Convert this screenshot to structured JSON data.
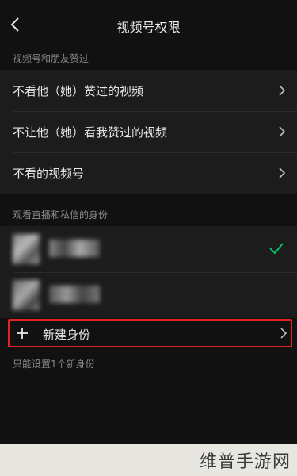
{
  "header": {
    "title": "视频号权限"
  },
  "section1": {
    "label": "视频号和朋友赞过",
    "items": [
      {
        "label": "不看他（她）赞过的视频"
      },
      {
        "label": "不让他（她）看我赞过的视频"
      },
      {
        "label": "不看的视频号"
      }
    ]
  },
  "section2": {
    "label": "观看直播和私信的身份",
    "identities": [
      {
        "selected": true
      },
      {
        "selected": false
      }
    ],
    "new_identity_label": "新建身份",
    "hint": "只能设置1个新身份"
  },
  "colors": {
    "accent_check": "#07c160",
    "highlight_border": "#e02424"
  },
  "watermark": "维普手游网"
}
